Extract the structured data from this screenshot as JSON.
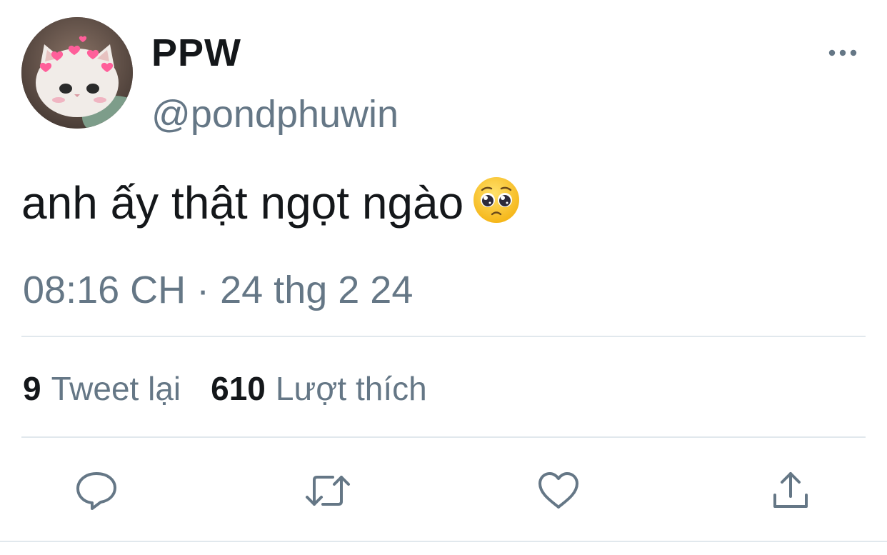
{
  "tweet": {
    "display_name": "PPW",
    "handle": "@pondphuwin",
    "text": "anh ấy thật ngọt ngào",
    "emoji": "pleading-face-emoji",
    "timestamp": "08:16 CH · 24 thg 2 24"
  },
  "stats": {
    "retweets_count": "9",
    "retweets_label": "Tweet lại",
    "likes_count": "610",
    "likes_label": "Lượt thích"
  },
  "actions": {
    "reply_icon": "reply-icon",
    "retweet_icon": "retweet-icon",
    "like_icon": "heart-icon",
    "share_icon": "share-icon"
  },
  "colors": {
    "text_primary": "#14171a",
    "text_secondary": "#657786",
    "divider": "#e1e8ed",
    "icon": "#657786"
  }
}
